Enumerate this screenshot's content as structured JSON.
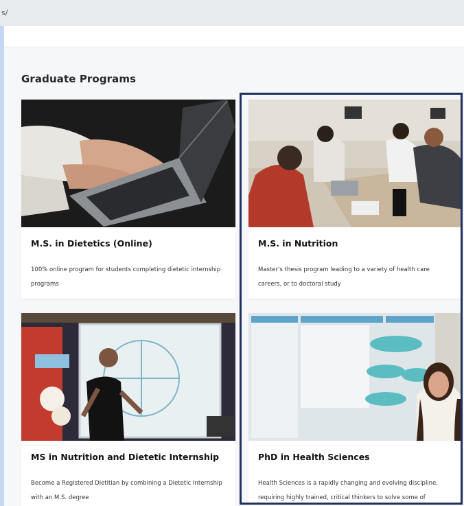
{
  "browser": {
    "url": "s/"
  },
  "section": {
    "title": "Graduate Programs"
  },
  "programs": [
    {
      "title": "M.S. in Dietetics (Online)",
      "description": "100% online program for students completing dietetic internship programs",
      "image": "laptop-typing-photo"
    },
    {
      "title": "M.S. in Nutrition",
      "description": "Master's thesis program leading to a variety of health care careers, or to doctoral study",
      "image": "students-classroom-photo"
    },
    {
      "title": "MS in Nutrition and Dietetic Internship",
      "description": "Become a Registered Dietitian by combining a Dietetic Internship with an M.S. degree",
      "image": "teacher-whiteboard-photo"
    },
    {
      "title": "PhD in Health Sciences",
      "description": "Health Sciences is a rapidly changing and evolving discipline, requiring highly trained, critical thinkers to solve some of",
      "image": "research-poster-photo"
    }
  ],
  "colors": {
    "highlight_border": "#1e2f63",
    "page_bg": "#f6f7f8",
    "frame_bg": "#c7d7f2"
  }
}
